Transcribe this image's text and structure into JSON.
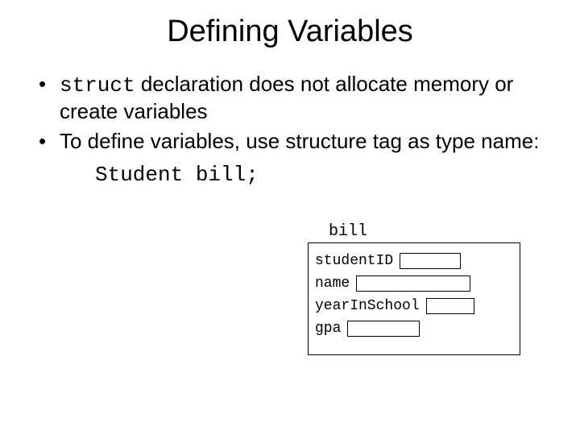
{
  "title": "Defining Variables",
  "bullets": {
    "b1": {
      "pre": "struct",
      "rest": " declaration does not allocate memory or create variables"
    },
    "b2": "To define variables, use structure tag as type name:"
  },
  "code_line": "Student bill;",
  "diagram": {
    "name": "bill",
    "fields": {
      "studentID": "studentID",
      "name": "name",
      "yearInSchool": "yearInSchool",
      "gpa": "gpa"
    }
  }
}
